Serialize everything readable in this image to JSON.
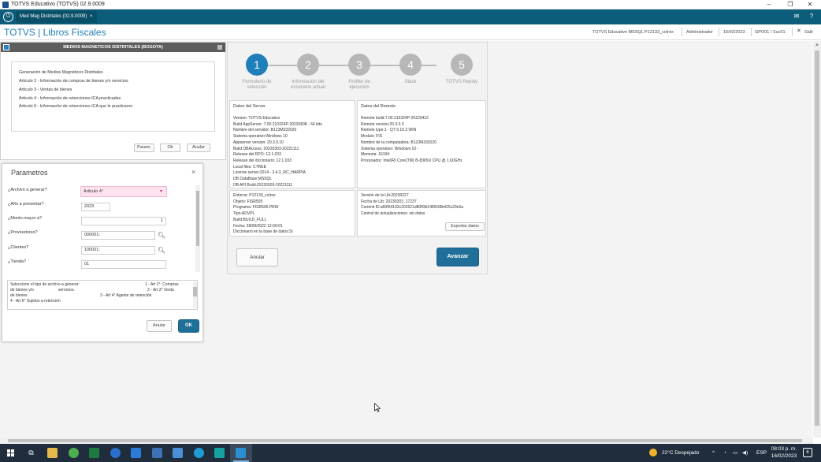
{
  "window": {
    "title": "TOTVS Educativo (TOTVS) 02.9.0009",
    "minimize": "–",
    "maximize": "❐",
    "close": "✕"
  },
  "tabbar": {
    "home_icon": "power-icon",
    "tab_label": "Med Mag Distritales (02.9.0009)",
    "tab_close": "×",
    "right_icons": [
      "mail-icon",
      "help-icon"
    ]
  },
  "header": {
    "app_title": "TOTVS | Libros Fiscales",
    "environment": "TOTVS Educativo MSSQL P12133_colrox",
    "user": "Administrador",
    "date": "16/02/2023",
    "branch": "GPO01 / Suc01",
    "exit": "Salir"
  },
  "mmd_dialog": {
    "title": "MEDIOS MAGNETICOS DISTRITALES (BOGOTA)",
    "lines": [
      "Generación de Medios Magnéticos Distritales",
      "Articulo 2 - Información de compras de bienes y/o servicios",
      "Articulo 3 - Ventas de bienes",
      "Articulo 4 - Información de retenciones ICA practicadas",
      "Articulo 6 - Información de retenciones ICA que le practicaron"
    ],
    "buttons": {
      "params": "Param.",
      "ok": "Ok",
      "cancel": "Anular"
    }
  },
  "params_dialog": {
    "title": "Parametros",
    "close": "×",
    "fields": {
      "archivo": {
        "label": "¿Archivo a generar?",
        "value": "Articulo 4°"
      },
      "anio": {
        "label": "¿Año a presentar?",
        "value": "2023"
      },
      "monto": {
        "label": "¿Monto mayor a?",
        "value": "1"
      },
      "proveedores": {
        "label": "¿Proveedores?",
        "value": "000001;"
      },
      "clientes": {
        "label": "¿Clientes?",
        "value": "100001;"
      },
      "tienda": {
        "label": "¿Tienda?",
        "value": "01"
      }
    },
    "description": {
      "l1a": "Seleccione el tipo de archivo a generar:",
      "l1b": "1 - Art 2°. Compras",
      "l2a": "de bienes y/o",
      "l2b": "servicios.",
      "l2c": "2 - Art 3° Venta",
      "l3a": "de bienes",
      "l3b": "3 - Art 4° Agente de retención",
      "l4a": "4 - Art 6° Sujetos a retención"
    },
    "buttons": {
      "cancel": "Anular",
      "ok": "OK"
    }
  },
  "wizard": {
    "steps": [
      {
        "num": "1",
        "label1": "Formulario de",
        "label2": "selección"
      },
      {
        "num": "2",
        "label1": "Informacion del",
        "label2": "escenario actual"
      },
      {
        "num": "3",
        "label1": "Profiler de",
        "label2": "ejecución"
      },
      {
        "num": "4",
        "label1": "Stack",
        "label2": ""
      },
      {
        "num": "5",
        "label1": "TOTVS Replay",
        "label2": ""
      }
    ],
    "server": {
      "title": "Datos del Server",
      "lines": [
        "Version: TOTVS Educativo",
        "Build AppServer: 7.00.210324P-20220608 - 64 bits",
        "Nombre del servidor: B123M332020",
        "Sistema operativo:Windows 10",
        "Appserver version: 20.3.0.10",
        "Build DBAccess: 20220303-20221111",
        "Release del RPO:  12.1.033",
        "Release del diccionario:  12.1.033",
        "Local files:  CTREE",
        "License server:2014 - 3.4.3_RC_HARPIA",
        "DB DataBase:MSSQL",
        "DB API Build:20220303-20221111"
      ]
    },
    "remote": {
      "title": "Datos del Remote",
      "lines": [
        "Remote build:7.00.210324P-20220412",
        "Remote version:20.3.0.3",
        "Remote type:1 - QT 5.15.3 WIN",
        "Modulo: FIS",
        "Nombre de la computadora: B123M332020",
        "Sistema operativo: Windows 10 -",
        "Memoria: 16194",
        "Procesador: Intel(R) Core(TM) i5-8365U CPU @ 1.60GHz"
      ]
    },
    "env": {
      "lines": [
        "Entorno: P12133_colrox",
        "Objeto: FISR505",
        "Programa: FISR505.PRW",
        "Tipo:ADVPL",
        "Build:BUILD_FULL",
        "Fecha: 28/09/2022 12:00:01",
        "Diccionario en la base de datos:Si"
      ]
    },
    "lib": {
      "lines": [
        "Versión de la Lib:20230227",
        "Fecha de Lib: 20230203_17237",
        "Commit ID:a50f54102c202521d80ff3b14f0538b425c20e5a",
        "Central de actualizaciones: sin datos"
      ],
      "export": "Exportar datos"
    },
    "buttons": {
      "cancel": "Anular",
      "next": "Avanzar"
    }
  },
  "taskbar": {
    "weather": "22°C  Despejado",
    "lang": "ESP",
    "time": "08:03 p. m.",
    "date": "16/02/2023",
    "notif": "6"
  }
}
